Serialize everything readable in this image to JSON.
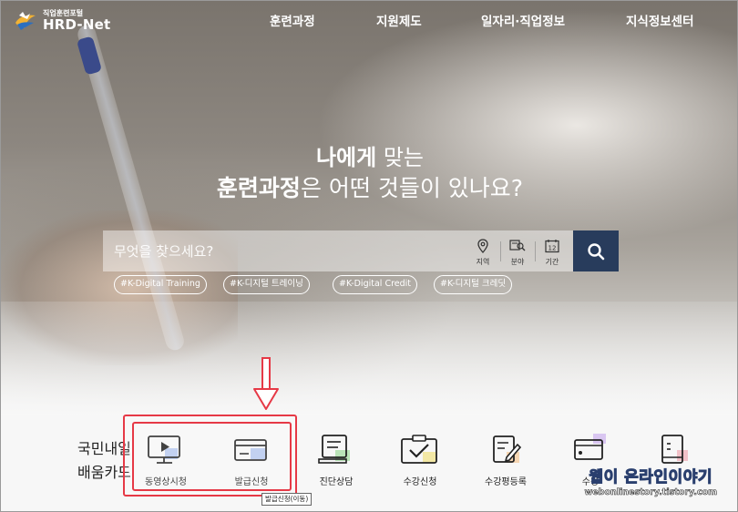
{
  "header": {
    "logo_portal": "직업훈련포털",
    "logo_name": "HRD-Net",
    "nav": [
      "훈련과정",
      "지원제도",
      "일자리·직업정보",
      "지식정보센터"
    ]
  },
  "hero": {
    "line1_bold": "나에게",
    "line1_rest": " 맞는",
    "line2_bold": "훈련과정",
    "line2_rest": "은 어떤 것들이 있나요?"
  },
  "search": {
    "placeholder": "무엇을 찾으세요?",
    "filters": [
      "지역",
      "분야",
      "기간"
    ],
    "calendar_day": "12"
  },
  "tags": [
    "#K-Digital Training",
    "#K-디지털 트레이닝",
    "#K-Digital Credit",
    "#K-디지털 크레딧"
  ],
  "services": {
    "title_line1": "국민내일",
    "title_line2": "배움카드",
    "items": [
      "동영상시청",
      "발급신청",
      "진단상담",
      "수강신청",
      "수강평등록",
      "수강"
    ]
  },
  "tooltip": "발급신청(이동)",
  "watermark": {
    "line1": "웹이 온라인이야기",
    "line2": "webonlinestory.tistory.com"
  },
  "colors": {
    "search_button": "#283c5c",
    "highlight": "#e63946"
  }
}
